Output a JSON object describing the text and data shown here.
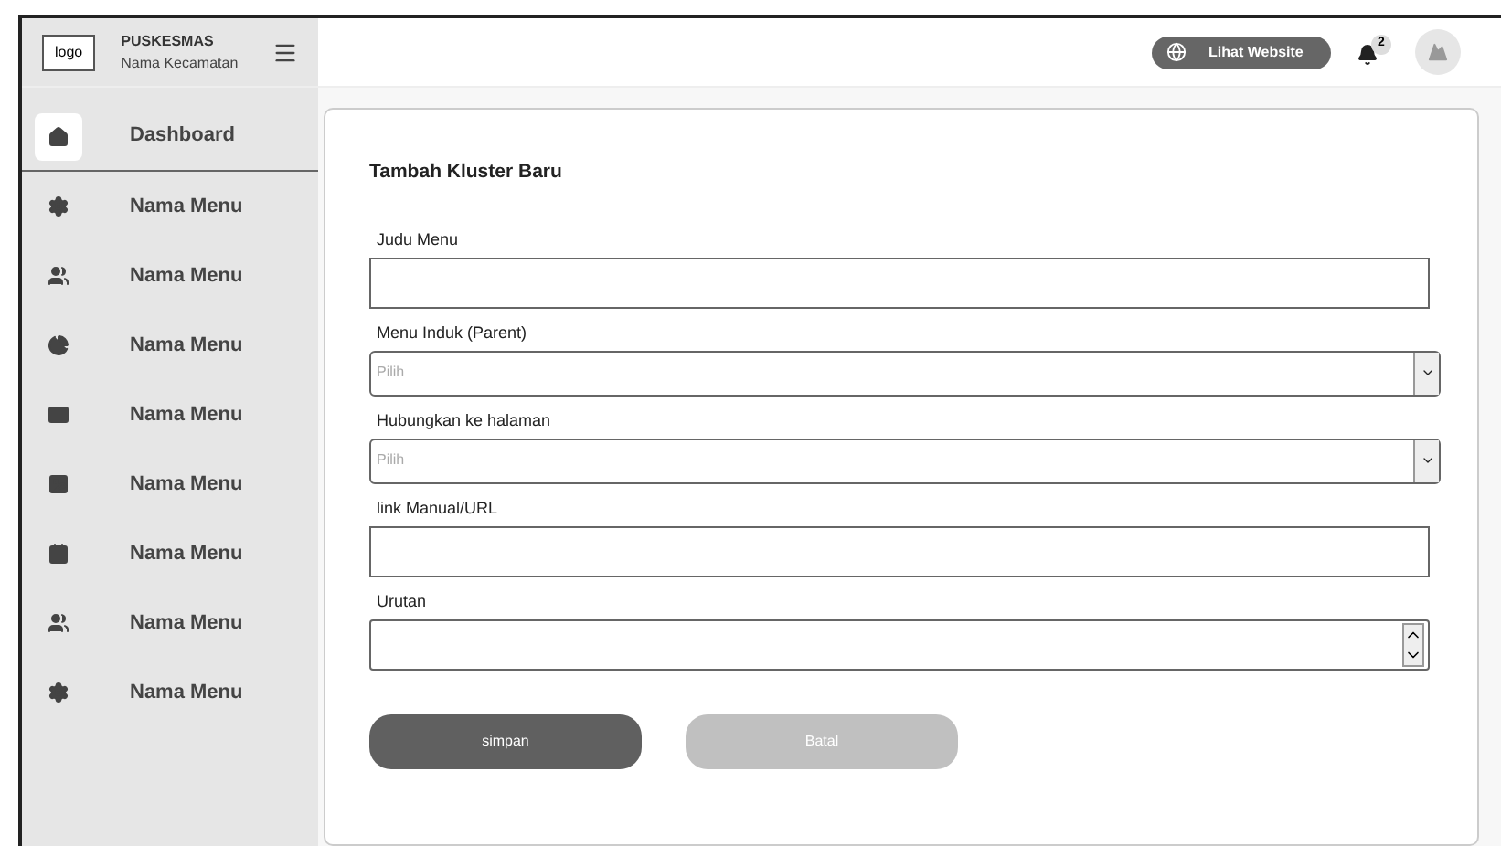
{
  "brand": {
    "logo": "logo",
    "title": "PUSKESMAS",
    "subtitle": "Nama Kecamatan"
  },
  "sidebar": {
    "items": [
      {
        "label": "Dashboard",
        "selected": true
      },
      {
        "label": "Nama Menu",
        "selected": false
      },
      {
        "label": "Nama Menu",
        "selected": false
      },
      {
        "label": "Nama Menu",
        "selected": false
      },
      {
        "label": "Nama Menu",
        "selected": false
      },
      {
        "label": "Nama Menu",
        "selected": false
      },
      {
        "label": "Nama Menu",
        "selected": false
      },
      {
        "label": "Nama Menu",
        "selected": false
      },
      {
        "label": "Nama Menu",
        "selected": false
      }
    ]
  },
  "header": {
    "website_button": "Lihat Website",
    "notification_count": "2"
  },
  "form": {
    "title": "Tambah Kluster Baru",
    "fields": [
      {
        "kind": "text",
        "label": "Judu Menu"
      },
      {
        "kind": "select",
        "label": "Menu Induk (Parent)",
        "placeholder": "Pilih"
      },
      {
        "kind": "select",
        "label": "Hubungkan ke halaman",
        "placeholder": "Pilih"
      },
      {
        "kind": "text",
        "label": "link Manual/URL"
      },
      {
        "kind": "number",
        "label": "Urutan"
      }
    ],
    "buttons": [
      {
        "label": "simpan",
        "disabled": false
      },
      {
        "label": "Batal",
        "disabled": true
      }
    ]
  }
}
